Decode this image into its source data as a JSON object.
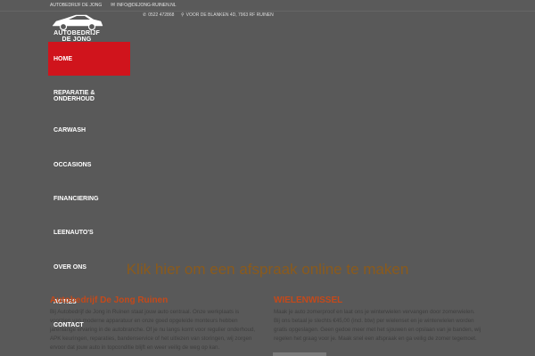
{
  "topbar": {
    "company": "AUTOBEDRIJF DE JONG",
    "email": "INFO@DEJONG-RUINEN.NL",
    "email_icon": "envelope-icon"
  },
  "logo": {
    "text_line1": "AUTOBEDRIJF",
    "text_line2": "DE JONG",
    "icon": "car-icon"
  },
  "contact": {
    "phone": "0522 472868",
    "phone_icon": "phone-icon",
    "address": "VOOR DE BLANKEN 4D, 7963 RF RUINEN",
    "address_icon": "map-marker-icon"
  },
  "nav": {
    "items": [
      {
        "label": "HOME",
        "active": true
      },
      {
        "label": "REPARATIE & ONDERHOUD",
        "active": false
      },
      {
        "label": "CARWASH",
        "active": false
      },
      {
        "label": "OCCASIONS",
        "active": false
      },
      {
        "label": "FINANCIERING",
        "active": false
      },
      {
        "label": "LEENAUTO'S",
        "active": false
      },
      {
        "label": "OVER ONS",
        "active": false
      },
      {
        "label": "ACTIES",
        "active": false
      },
      {
        "label": "CONTACT",
        "active": false
      }
    ]
  },
  "cta": {
    "text": "Klik hier om een afspraak online te maken"
  },
  "section_left": {
    "title": "Autobedrijf De Jong Ruinen",
    "lines": [
      "Bij Autobedrijf de Jong in Ruinen staat jouw auto centraal. Onze werkplaats is",
      "voorzien van moderne apparatuur en onze goed opgeleide monteurs hebben",
      "jarenlange ervaring in de autobranche. Of je nu langs komt voor regulier onderhoud,",
      "APK keuringen, reparaties, bandenservice of het uitlezen van storingen, wij zorgen",
      "ervoor dat jouw auto in topconditie blijft en weer veilig de weg op kan."
    ]
  },
  "section_right": {
    "title": "WIELENWISSEL",
    "lines": [
      "Maak je auto zomerproof en laat ons je winterwielen vervangen door zomerwielen.",
      "Bij ons betaal je slechts €45,00 (incl. btw) per wielenset en je winterwielen worden",
      "gratis opgeslagen. Geen gedoe meer met het sjouwen en opslaan van je banden, wij",
      "regelen het graag voor je. Maak snel een afspraak en ga veilig de zomer tegemoet."
    ]
  },
  "colors": {
    "overlay": "#595959",
    "accent_red": "#d0141c",
    "heading_orange": "#c4491a",
    "cta_brown": "#8a5a1c"
  }
}
